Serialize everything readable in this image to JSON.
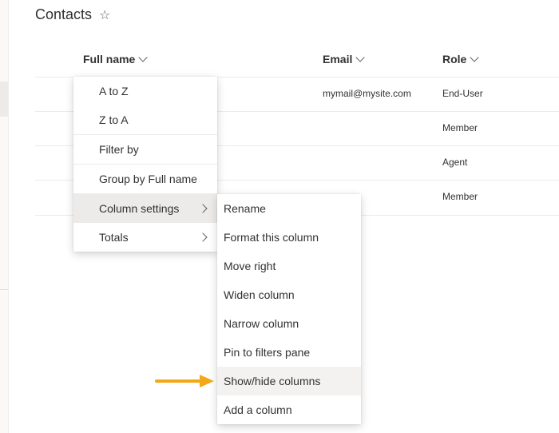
{
  "page": {
    "title": "Contacts"
  },
  "columns": {
    "full_name": "Full name",
    "email": "Email",
    "role": "Role"
  },
  "rows": [
    {
      "email": "mymail@mysite.com",
      "role": "End-User"
    },
    {
      "email": "",
      "role": "Member"
    },
    {
      "email": "",
      "role": "Agent"
    },
    {
      "email": "",
      "role": "Member"
    }
  ],
  "header_menu": {
    "items": [
      "A to Z",
      "Z to A",
      "Filter by",
      "Group by Full name",
      "Column settings",
      "Totals"
    ]
  },
  "column_settings_menu": {
    "items": [
      "Rename",
      "Format this column",
      "Move right",
      "Widen column",
      "Narrow column",
      "Pin to filters pane",
      "Show/hide columns",
      "Add a column"
    ]
  },
  "colors": {
    "accent_arrow": "#f2a818",
    "menu_highlight": "#edebe9"
  },
  "icons": {
    "favorite": "star-outline-icon",
    "sort": "chevron-down-icon",
    "submenu": "chevron-right-icon",
    "callout": "arrow-right-icon"
  }
}
